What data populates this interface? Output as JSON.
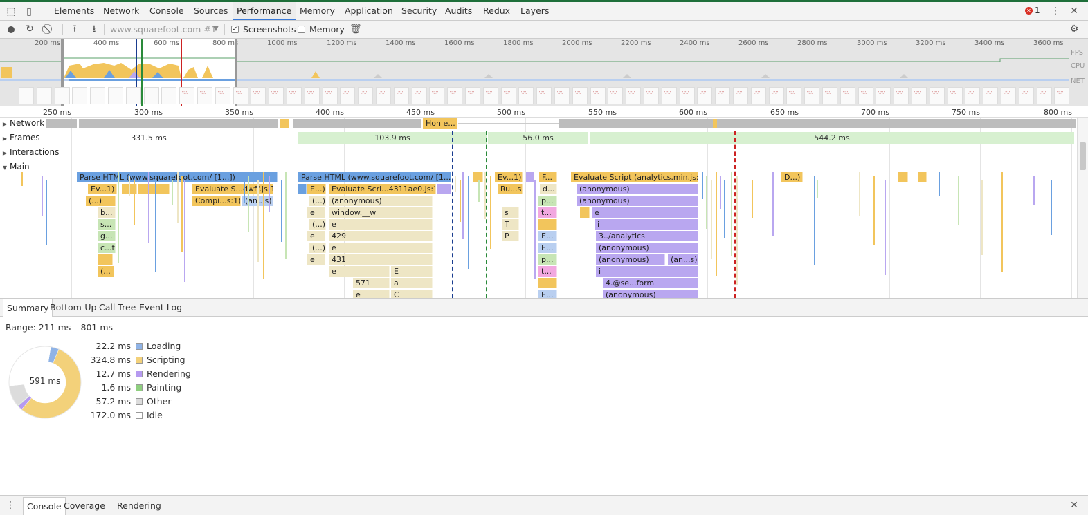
{
  "tabs": [
    "Elements",
    "Network",
    "Console",
    "Sources",
    "Performance",
    "Memory",
    "Application",
    "Security",
    "Audits",
    "Redux",
    "Layers"
  ],
  "error_count": "1",
  "toolbar": {
    "profile_select": "www.squarefoot.com #1",
    "screenshots_label": "Screenshots",
    "memory_label": "Memory",
    "screenshots_checked": true,
    "memory_checked": false
  },
  "overview": {
    "ticks": [
      "200 ms",
      "400 ms",
      "600 ms",
      "800 ms",
      "1000 ms",
      "1200 ms",
      "1400 ms",
      "1600 ms",
      "1800 ms",
      "2000 ms",
      "2200 ms",
      "2400 ms",
      "2600 ms",
      "2800 ms",
      "3000 ms",
      "3200 ms",
      "3400 ms",
      "3600 ms"
    ],
    "labels": {
      "fps": "FPS",
      "cpu": "CPU",
      "net": "NET"
    }
  },
  "ruler_ticks": [
    "250 ms",
    "300 ms",
    "350 ms",
    "400 ms",
    "450 ms",
    "500 ms",
    "550 ms",
    "600 ms",
    "650 ms",
    "700 ms",
    "750 ms",
    "800 ms"
  ],
  "tracks": {
    "network": "Network",
    "frames": "Frames",
    "interactions": "Interactions",
    "main": "Main"
  },
  "network_item": "Hon e...",
  "frames": [
    "331.5 ms",
    "103.9 ms",
    "56.0 ms",
    "544.2 ms"
  ],
  "flame": {
    "parse_html_1": "Parse HTML (www.squarefoot.com/ [1...])",
    "parse_html_2": "Parse HTML (www.squarefoot.com/ [1...])",
    "ev1": "Ev...1)",
    "eval_dwff": "Evaluate S...dwff.js:1)",
    "paren1": "(...)",
    "compi": "Compi...s:1)",
    "an_s": "(an...s)",
    "b_": "b...",
    "s_": "s...",
    "g_": "g...",
    "c_t": "c...t",
    "paren2": "(...",
    "e_": "E...)",
    "eval_4311": "Evaluate Scri...4311ae0.js:1)",
    "paren3": "(...)",
    "anonymous1": "(anonymous)",
    "e1": "e",
    "window_w": "window.__w",
    "paren4": "(...)",
    "e2": "e",
    "e3": "e",
    "n429": "429",
    "paren5": "(...)",
    "e4": "e",
    "e5": "e",
    "n431": "431",
    "e6": "e",
    "E1": "E",
    "n571": "571",
    "a1": "a",
    "e7": "e",
    "C1": "C",
    "ev2": "Ev...1)",
    "ru_s": "Ru...s",
    "s2": "s",
    "P1": "P",
    "T1": "T",
    "P2": "P",
    "F_": "F...",
    "d_": "d...",
    "p_": "p...",
    "t_": "t...",
    "E_a": "E...",
    "E_b": "E...",
    "p2_": "p...",
    "t2_": "t...",
    "E_c": "E...",
    "eval_analytics": "Evaluate Script (analytics.min.js:1)",
    "anon_a": "(anonymous)",
    "anon_b": "(anonymous)",
    "e_c": "e",
    "i1": "i",
    "analytics3": "3../analytics",
    "anon_c": "(anonymous)",
    "anon_d": "(anonymous)",
    "an_s2": "(an...s)",
    "i2": "i",
    "se_form": "4.@se...form",
    "anon_e": "(anonymous)",
    "D_": "D...)"
  },
  "bottom_tabs": [
    "Summary",
    "Bottom-Up",
    "Call Tree",
    "Event Log"
  ],
  "summary": {
    "range": "Range: 211 ms – 801 ms",
    "total": "591 ms",
    "items": [
      {
        "value": "22.2 ms",
        "name": "Loading",
        "color": "#8fb3e6"
      },
      {
        "value": "324.8 ms",
        "name": "Scripting",
        "color": "#f3d17a"
      },
      {
        "value": "12.7 ms",
        "name": "Rendering",
        "color": "#b69af0"
      },
      {
        "value": "1.6 ms",
        "name": "Painting",
        "color": "#8fcf7f"
      },
      {
        "value": "57.2 ms",
        "name": "Other",
        "color": "#dcdcdc"
      },
      {
        "value": "172.0 ms",
        "name": "Idle",
        "color": "#ffffff"
      }
    ],
    "durations_ms": [
      22.2,
      324.8,
      12.7,
      1.6,
      57.2,
      172.0
    ]
  },
  "drawer_tabs": [
    "Console",
    "Coverage",
    "Rendering"
  ],
  "icons": {
    "inspect": "inspect-icon",
    "device": "device-toolbar-icon",
    "record": "record-icon",
    "reload": "reload-icon",
    "clear": "clear-icon",
    "upload": "upload-icon",
    "download": "download-icon",
    "trash": "trash-icon",
    "gear": "gear-icon",
    "more": "more-icon",
    "close": "close-icon",
    "error": "error-icon"
  }
}
